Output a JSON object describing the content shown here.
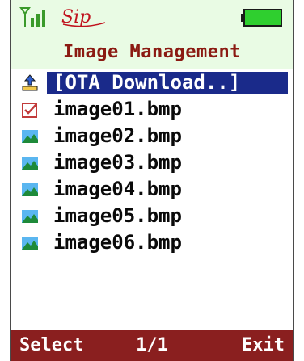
{
  "status": {
    "sip_label": "Sip",
    "colors": {
      "signal": "#3a9a2a",
      "sip": "#c0121d",
      "battery": "#2fcf2f"
    }
  },
  "title": "Image Management",
  "list": {
    "items": [
      {
        "label": "[OTA Download..]",
        "icon": "ota-download-icon",
        "selected": true
      },
      {
        "label": "image01.bmp",
        "icon": "checkbox-checked-icon",
        "selected": false
      },
      {
        "label": "image02.bmp",
        "icon": "image-file-icon",
        "selected": false
      },
      {
        "label": "image03.bmp",
        "icon": "image-file-icon",
        "selected": false
      },
      {
        "label": "image04.bmp",
        "icon": "image-file-icon",
        "selected": false
      },
      {
        "label": "image05.bmp",
        "icon": "image-file-icon",
        "selected": false
      },
      {
        "label": "image06.bmp",
        "icon": "image-file-icon",
        "selected": false
      }
    ]
  },
  "softkeys": {
    "left": "Select",
    "center": "1/1",
    "right": "Exit"
  },
  "colors": {
    "title": "#8b1a12",
    "highlight": "#1a2a8a",
    "softbar": "#8a1f1f",
    "header_bg": "#e9fbe4"
  }
}
